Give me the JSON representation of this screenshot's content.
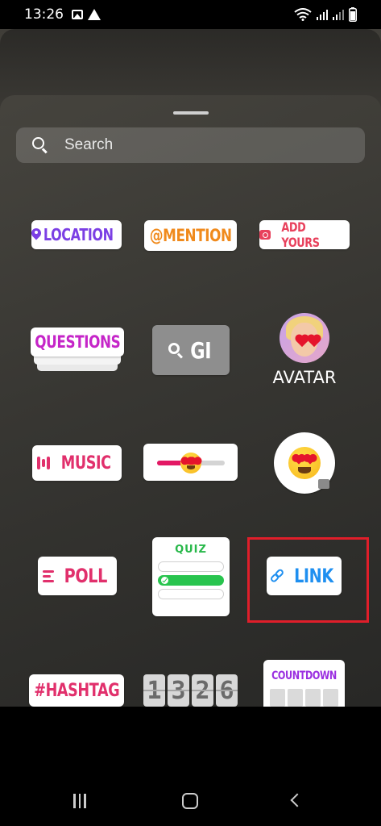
{
  "status_bar": {
    "time": "13:26",
    "left_icons": [
      "image-icon",
      "warning-icon"
    ],
    "right_icons": [
      "wifi-icon",
      "signal-icon",
      "signal-icon",
      "battery-icon"
    ]
  },
  "search": {
    "placeholder": "Search"
  },
  "stickers": {
    "location": "LOCATION",
    "mention": "@MENTION",
    "add_yours": "ADD YOURS",
    "questions": "QUESTIONS",
    "gif": "GI",
    "avatar": "AVATAR",
    "music": "MUSIC",
    "poll": "POLL",
    "quiz": "QUIZ",
    "link": "LINK",
    "hashtag": "#HASHTAG",
    "clock_digits": [
      "1",
      "3",
      "2",
      "6"
    ],
    "countdown": "COUNTDOWN",
    "slider_level": 0.55
  },
  "colors": {
    "highlight": "#e01e2a",
    "location": "#7b3fe4",
    "mention": "#f08a1c",
    "add_yours": "#e8415c",
    "questions": "#c525c8",
    "music": "#e1306c",
    "link": "#1e8ff0",
    "quiz": "#28b84a",
    "countdown": "#9a2ee0"
  },
  "nav": {
    "icons": [
      "recents-icon",
      "home-icon",
      "back-icon"
    ]
  }
}
